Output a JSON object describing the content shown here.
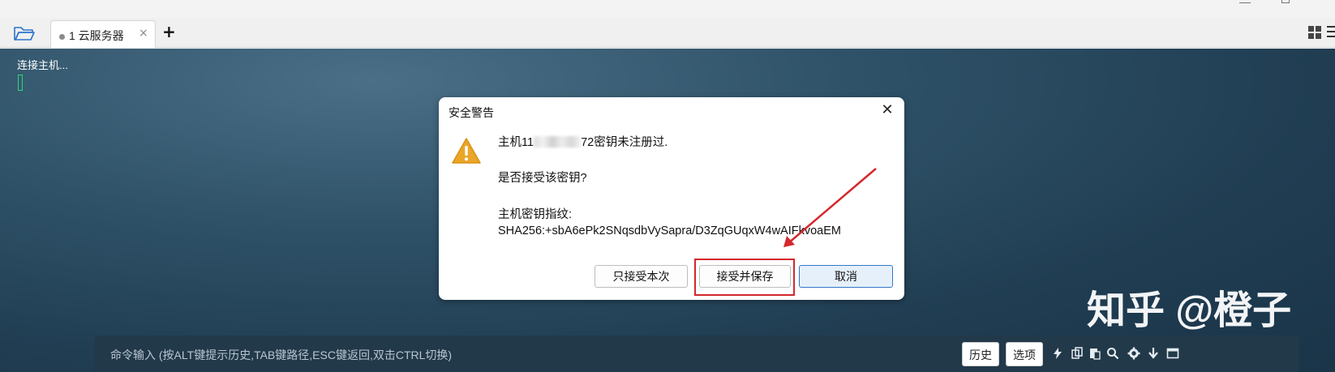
{
  "tabbar": {
    "tab_label": "1 云服务器",
    "tab_close": "×",
    "add_tab": "+"
  },
  "terminal": {
    "status_line": "连接主机...",
    "watermark": "知乎 @橙子"
  },
  "dialog": {
    "title": "安全警告",
    "close": "✕",
    "message_prefix": "主机11",
    "message_suffix": "72密钥未注册过.",
    "question": "是否接受该密钥?",
    "fingerprint_label": "主机密钥指纹:",
    "fingerprint_value": "SHA256:+sbA6ePk2SNqsdbVySapra/D3ZqGUqxW4wAIFkvoaEM",
    "buttons": {
      "accept_once": "只接受本次",
      "accept_save": "接受并保存",
      "cancel": "取消"
    }
  },
  "cmdbar": {
    "placeholder": "命令输入 (按ALT键提示历史,TAB键路径,ESC键返回,双击CTRL切换)",
    "history_label": "历史",
    "options_label": "选项"
  },
  "colors": {
    "terminal_bg": "#2f5268",
    "highlight": "#d3282d",
    "primary_button_border": "#2f78c8",
    "cursor": "#2fd67a"
  },
  "icons": [
    "folder-icon",
    "grid-icon",
    "menu-icon",
    "warning-icon",
    "lightning-icon",
    "copy-icon",
    "paste-icon",
    "search-icon",
    "gear-icon",
    "download-icon",
    "window-icon"
  ]
}
